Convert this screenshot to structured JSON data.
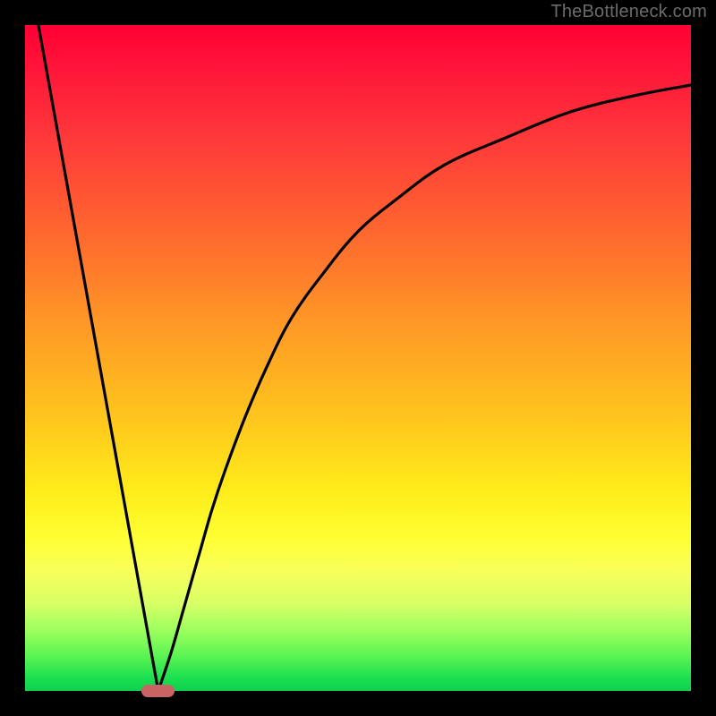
{
  "watermark": "TheBottleneck.com",
  "chart_data": {
    "type": "line",
    "title": "",
    "xlabel": "",
    "ylabel": "",
    "xlim": [
      0,
      100
    ],
    "ylim": [
      0,
      100
    ],
    "grid": false,
    "legend": false,
    "series": [
      {
        "name": "left-arm",
        "x": [
          2,
          20
        ],
        "y": [
          100,
          0
        ]
      },
      {
        "name": "right-arm",
        "x": [
          20,
          22,
          24,
          26,
          28,
          30,
          33,
          36,
          40,
          45,
          50,
          56,
          63,
          72,
          82,
          92,
          100
        ],
        "y": [
          0,
          6,
          13,
          20,
          27,
          33,
          41,
          48,
          56,
          63,
          69,
          74,
          79,
          83,
          87,
          89.5,
          91
        ]
      }
    ],
    "marker": {
      "x_center": 20,
      "y": 0,
      "width_pct": 5
    }
  },
  "gradient_stops": [
    {
      "pct": 0,
      "color": "#ff0033"
    },
    {
      "pct": 45,
      "color": "#ff9926"
    },
    {
      "pct": 77,
      "color": "#ffff33"
    },
    {
      "pct": 100,
      "color": "#0ed04c"
    }
  ]
}
